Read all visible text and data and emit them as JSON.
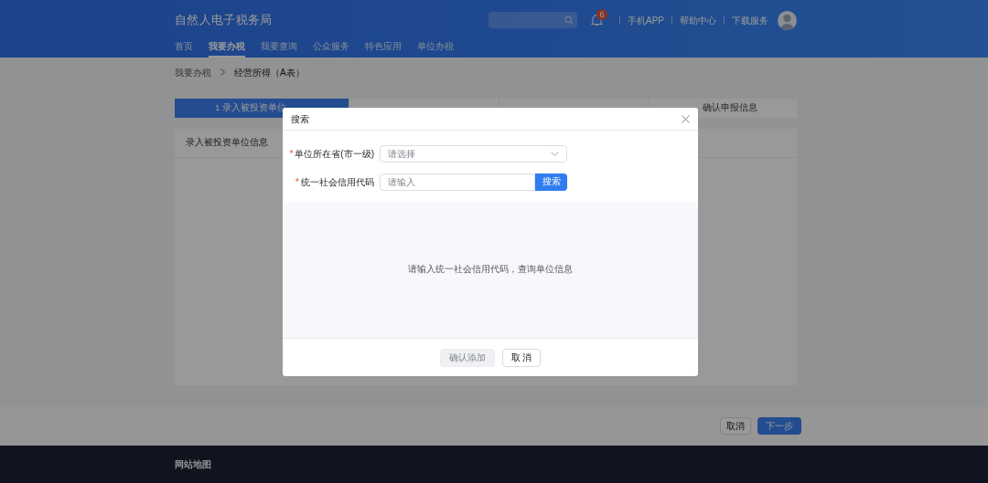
{
  "header": {
    "title": "自然人电子税务局",
    "notification_count": "6",
    "links": [
      "手机APP",
      "帮助中心",
      "下载服务"
    ]
  },
  "nav": [
    {
      "label": "首页",
      "selected": false
    },
    {
      "label": "我要办税",
      "selected": true
    },
    {
      "label": "我要查询",
      "selected": false
    },
    {
      "label": "公众服务",
      "selected": false
    },
    {
      "label": "特色应用",
      "selected": false
    },
    {
      "label": "单位办税",
      "selected": false
    }
  ],
  "breadcrumb": [
    "我要办税",
    "经营所得（A表）"
  ],
  "steps": [
    {
      "label": "1  录入被投资单位",
      "selected": true
    },
    {
      "selected": false
    },
    {
      "selected": false
    },
    {
      "label": "确认申报信息",
      "selected": false
    }
  ],
  "card": {
    "title": "录入被投资单位信息"
  },
  "dialog": {
    "title": "搜索",
    "fields": [
      {
        "kind": "select",
        "label": "单位所在省(市一级)",
        "required_mark": "*",
        "placeholder": "请选择"
      },
      {
        "kind": "search",
        "label": "统一社会信用代码",
        "required_mark": "*",
        "placeholder": "请输入",
        "button": "搜索"
      }
    ],
    "empty_text": "请输入统一社会信用代码，查询单位信息",
    "buttons": [
      {
        "label": "确认添加",
        "disabled": true
      },
      {
        "label": "取 消",
        "disabled": false
      }
    ]
  },
  "bottom_buttons": [
    {
      "label": "取消",
      "kind": "default"
    },
    {
      "label": "下一步",
      "kind": "primary"
    }
  ],
  "footer": {
    "link": "网站地图"
  }
}
